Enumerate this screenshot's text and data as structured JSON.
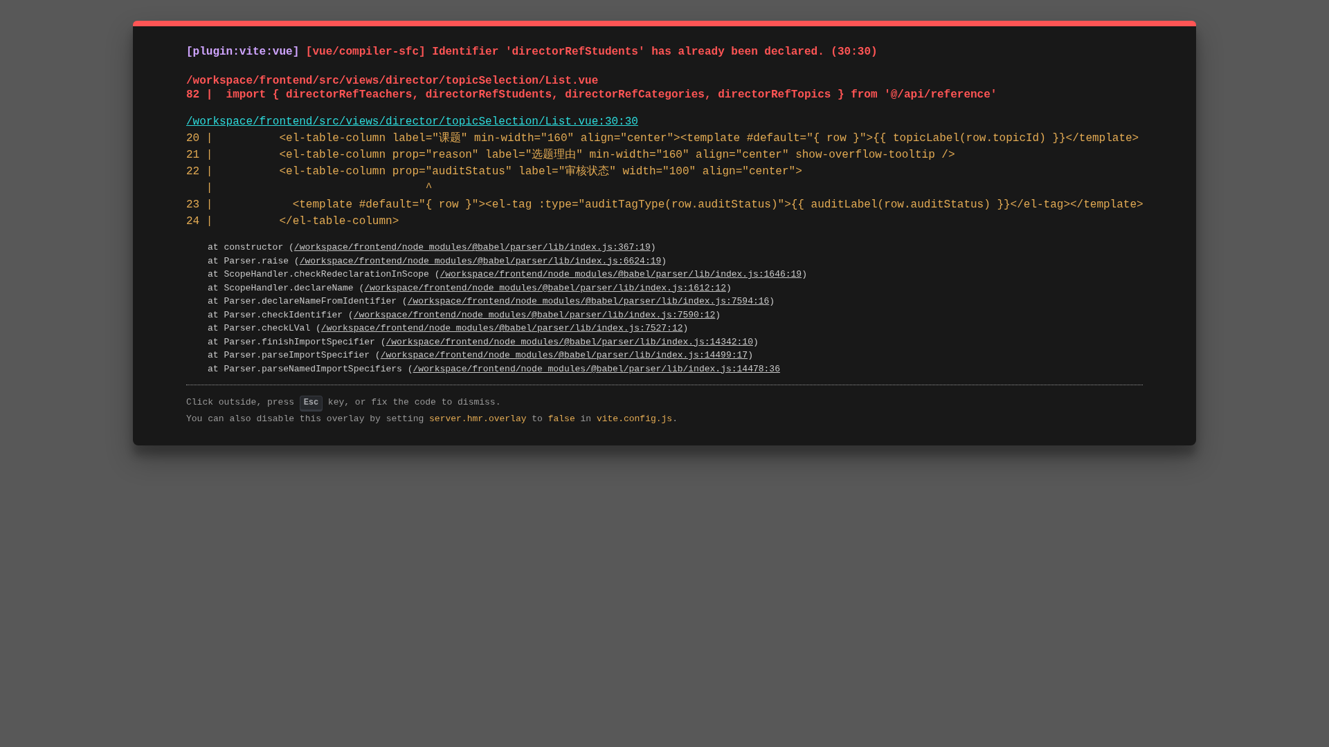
{
  "error_overlay": {
    "plugin": "[plugin:vite:vue]",
    "message": "[vue/compiler-sfc] Identifier 'directorRefStudents' has already been declared. (30:30)",
    "message_file": "/workspace/frontend/src/views/director/topicSelection/List.vue",
    "message_source": "82 |  import { directorRefTeachers, directorRefStudents, directorRefCategories, directorRefTopics } from '@/api/reference'",
    "file_link": "/workspace/frontend/src/views/director/topicSelection/List.vue:30:30",
    "code_frame": [
      "20 |          <el-table-column label=\"课题\" min-width=\"160\" align=\"center\"><template #default=\"{ row }\">{{ topicLabel(row.topicId) }}</template>",
      "21 |          <el-table-column prop=\"reason\" label=\"选题理由\" min-width=\"160\" align=\"center\" show-overflow-tooltip />",
      "22 |          <el-table-column prop=\"auditStatus\" label=\"审核状态\" width=\"100\" align=\"center\">",
      "   |                                ^",
      "23 |            <template #default=\"{ row }\"><el-tag :type=\"auditTagType(row.auditStatus)\">{{ auditLabel(row.auditStatus) }}</el-tag></template>",
      "24 |          </el-table-column>"
    ],
    "stack": [
      {
        "text": "at constructor (",
        "link": "/workspace/frontend/node_modules/@babel/parser/lib/index.js:367:19",
        "after": ")"
      },
      {
        "text": "at Parser.raise (",
        "link": "/workspace/frontend/node_modules/@babel/parser/lib/index.js:6624:19",
        "after": ")"
      },
      {
        "text": "at ScopeHandler.checkRedeclarationInScope (",
        "link": "/workspace/frontend/node_modules/@babel/parser/lib/index.js:1646:19",
        "after": ")"
      },
      {
        "text": "at ScopeHandler.declareName (",
        "link": "/workspace/frontend/node_modules/@babel/parser/lib/index.js:1612:12",
        "after": ")"
      },
      {
        "text": "at Parser.declareNameFromIdentifier (",
        "link": "/workspace/frontend/node_modules/@babel/parser/lib/index.js:7594:16",
        "after": ")"
      },
      {
        "text": "at Parser.checkIdentifier (",
        "link": "/workspace/frontend/node_modules/@babel/parser/lib/index.js:7590:12",
        "after": ")"
      },
      {
        "text": "at Parser.checkLVal (",
        "link": "/workspace/frontend/node_modules/@babel/parser/lib/index.js:7527:12",
        "after": ")"
      },
      {
        "text": "at Parser.finishImportSpecifier (",
        "link": "/workspace/frontend/node_modules/@babel/parser/lib/index.js:14342:10",
        "after": ")"
      },
      {
        "text": "at Parser.parseImportSpecifier (",
        "link": "/workspace/frontend/node_modules/@babel/parser/lib/index.js:14499:17",
        "after": ")"
      },
      {
        "text": "at Parser.parseNamedImportSpecifiers (",
        "link": "/workspace/frontend/node_modules/@babel/parser/lib/index.js:14478:36"
      }
    ],
    "tips": [
      [
        {
          "kind": "text",
          "text": "Click outside, press "
        },
        {
          "kind": "key",
          "text": "Esc"
        },
        {
          "kind": "text",
          "text": " key, or fix the code to dismiss."
        }
      ],
      [
        {
          "kind": "text",
          "text": "You can also disable this overlay by setting "
        },
        {
          "kind": "code",
          "text": "server.hmr.overlay"
        },
        {
          "kind": "text",
          "text": " to "
        },
        {
          "kind": "code",
          "text": "false"
        },
        {
          "kind": "text",
          "text": " in "
        },
        {
          "kind": "code",
          "text": "vite.config.js"
        },
        {
          "kind": "text",
          "text": "."
        }
      ]
    ]
  }
}
